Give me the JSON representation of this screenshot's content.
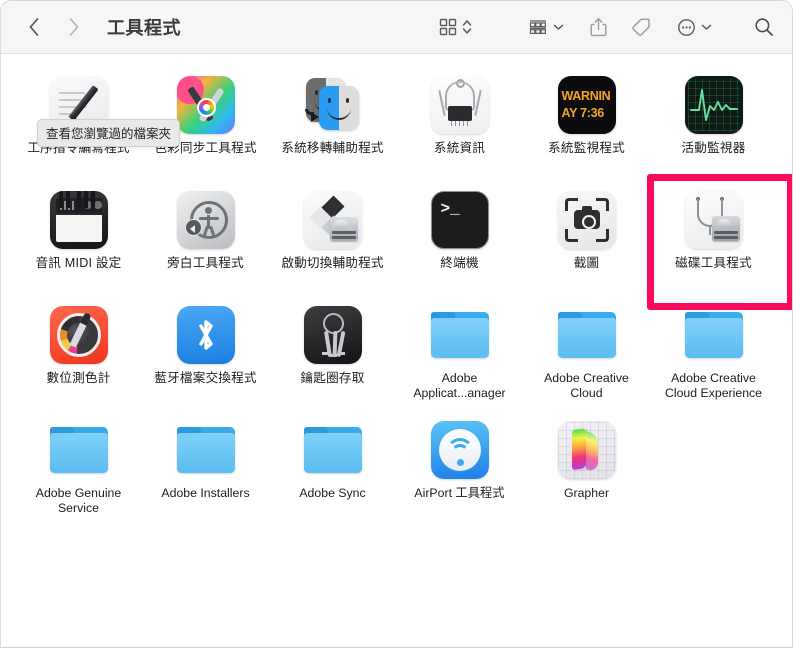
{
  "window": {
    "title": "工具程式"
  },
  "toolbar": {
    "back_label": "back-arrow",
    "forward_label": "forward-arrow",
    "icon_view_label": "icon-view",
    "view_sort_label": "view-options",
    "group_label": "group-by",
    "share_label": "share",
    "tag_label": "tag",
    "more_label": "more-actions",
    "search_label": "search"
  },
  "tooltip": {
    "text": "查看您瀏覽過的檔案夾"
  },
  "highlight": {
    "color": "#FC0A5F",
    "target": "磁碟工具程式"
  },
  "items": [
    {
      "label": "工序指令編寫程式",
      "icon": "script-editor-icon",
      "cjk": true
    },
    {
      "label": "色彩同步工具程式",
      "icon": "colorsync-utility-icon",
      "cjk": true
    },
    {
      "label": "系統移轉輔助程式",
      "icon": "migration-assistant-icon",
      "cjk": true
    },
    {
      "label": "系統資訊",
      "icon": "system-information-icon",
      "cjk": true
    },
    {
      "label": "系統監視程式",
      "icon": "system-monitor-icon",
      "cjk": true
    },
    {
      "label": "活動監視器",
      "icon": "activity-monitor-icon",
      "cjk": true
    },
    {
      "label": "音訊 MIDI 設定",
      "icon": "audio-midi-setup-icon",
      "cjk": true
    },
    {
      "label": "旁白工具程式",
      "icon": "voiceover-utility-icon",
      "cjk": true
    },
    {
      "label": "啟動切換輔助程式",
      "icon": "boot-camp-assistant-icon",
      "cjk": true
    },
    {
      "label": "終端機",
      "icon": "terminal-icon",
      "cjk": true
    },
    {
      "label": "截圖",
      "icon": "screenshot-icon",
      "cjk": true
    },
    {
      "label": "磁碟工具程式",
      "icon": "disk-utility-icon",
      "cjk": true,
      "highlighted": true
    },
    {
      "label": "數位測色計",
      "icon": "digital-color-meter-icon",
      "cjk": true
    },
    {
      "label": "藍牙檔案交換程式",
      "icon": "bluetooth-file-exchange-icon",
      "cjk": true
    },
    {
      "label": "鑰匙圈存取",
      "icon": "keychain-access-icon",
      "cjk": true
    },
    {
      "label": "Adobe Applicat...anager",
      "icon": "folder-icon",
      "cjk": false
    },
    {
      "label": "Adobe Creative Cloud",
      "icon": "folder-icon",
      "cjk": false
    },
    {
      "label": "Adobe Creative Cloud Experience",
      "icon": "folder-icon",
      "cjk": false
    },
    {
      "label": "Adobe Genuine Service",
      "icon": "folder-icon",
      "cjk": false
    },
    {
      "label": "Adobe Installers",
      "icon": "folder-icon",
      "cjk": false
    },
    {
      "label": "Adobe Sync",
      "icon": "folder-icon",
      "cjk": false
    },
    {
      "label": "AirPort 工具程式",
      "icon": "airport-utility-icon",
      "cjk": false
    },
    {
      "label": "Grapher",
      "icon": "grapher-icon",
      "cjk": false
    }
  ],
  "system_monitor_icon_text": {
    "line1": "WARNIN",
    "line2": "AY 7:36"
  }
}
